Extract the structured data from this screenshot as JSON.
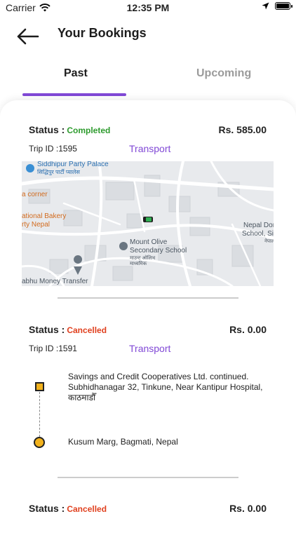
{
  "status_bar": {
    "carrier": "Carrier",
    "time": "12:35 PM"
  },
  "header": {
    "title": "Your Bookings"
  },
  "tabs": [
    {
      "label": "Past"
    },
    {
      "label": "Upcoming"
    }
  ],
  "bookings": [
    {
      "status_label": "Status :",
      "status_value": "Completed",
      "price": "Rs. 585.00",
      "trip_id": "Trip ID :1595",
      "type": "Transport",
      "map": {
        "labels": [
          "Siddhipur Party Palace",
          "सिद्धिपुर पार्टी प्यालेस",
          "a corner",
          "ational Bakery",
          "rty Nepal",
          "Mount Olive",
          "Secondary School",
          "माउन्ट ओलिभ",
          "माध्यमिक",
          "Nepal Don",
          "School, Sid",
          "नेपाल",
          "abhu Money Transfer"
        ]
      }
    },
    {
      "status_label": "Status :",
      "status_value": "Cancelled",
      "price": "Rs. 0.00",
      "trip_id": "Trip ID :1591",
      "type": "Transport",
      "pickup": "Savings and Credit Cooperatives Ltd. continued. Subhidhanagar 32, Tinkune, Near Kantipur Hospital, काठमाडौँ",
      "dropoff": "Kusum Marg, Bagmati, Nepal"
    },
    {
      "status_label": "Status :",
      "status_value": "Cancelled",
      "price": "Rs. 0.00"
    }
  ]
}
